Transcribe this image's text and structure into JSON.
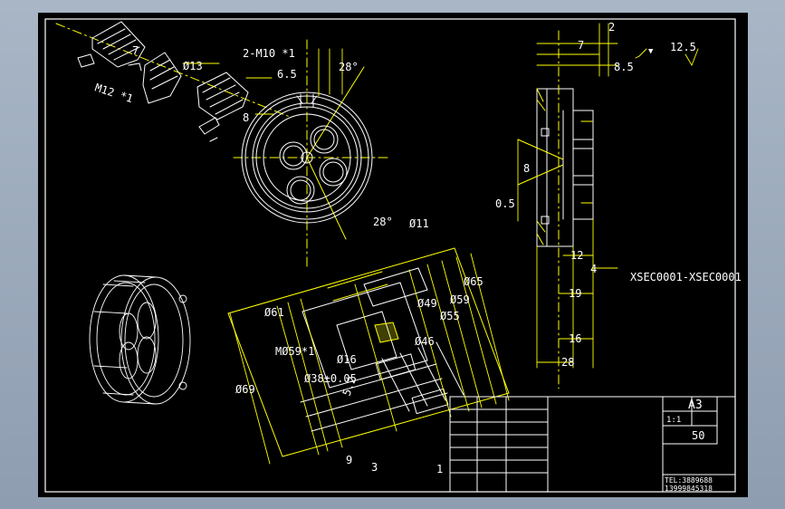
{
  "labels": {
    "thread_m12": "M12 *1",
    "dim_7_top": "7",
    "dia_13": "Ø13",
    "thread_m10": "2-M10 *1",
    "dim_6_5": "6.5",
    "dim_8_left": "8",
    "angle_28_top": "28°",
    "angle_28_bot": "28°",
    "dia_11": "Ø11",
    "dim_2": "2",
    "dim_7_right": "7",
    "dim_8_5": "8.5",
    "finish_symbol": "▼",
    "roughness": "12.5",
    "dim_8_side": "8",
    "dim_0_5": "0.5",
    "dim_12": "12",
    "dim_4": "4",
    "ref_text": "XSEC0001-XSEC0001",
    "dim_19": "19",
    "dim_16": "16",
    "dim_28_bottom": "28",
    "dia_65": "Ø65",
    "dia_59": "Ø59",
    "dia_49": "Ø49",
    "dia_55": "Ø55",
    "dia_46": "Ø46",
    "dia_61": "Ø61",
    "thread_m59": "MØ59*1",
    "dia_16": "Ø16",
    "dia_38": "Ø38±0.05",
    "dia_69": "Ø69",
    "dim_9": "9",
    "dim_3": "3",
    "dim_1": "1",
    "dim_5_2": "5.2",
    "tb_size": "A3",
    "tb_sheet": "1:1",
    "tb_scale": "50",
    "tb_tel": "TEL:3889688",
    "tb_phone": "13999845318"
  }
}
